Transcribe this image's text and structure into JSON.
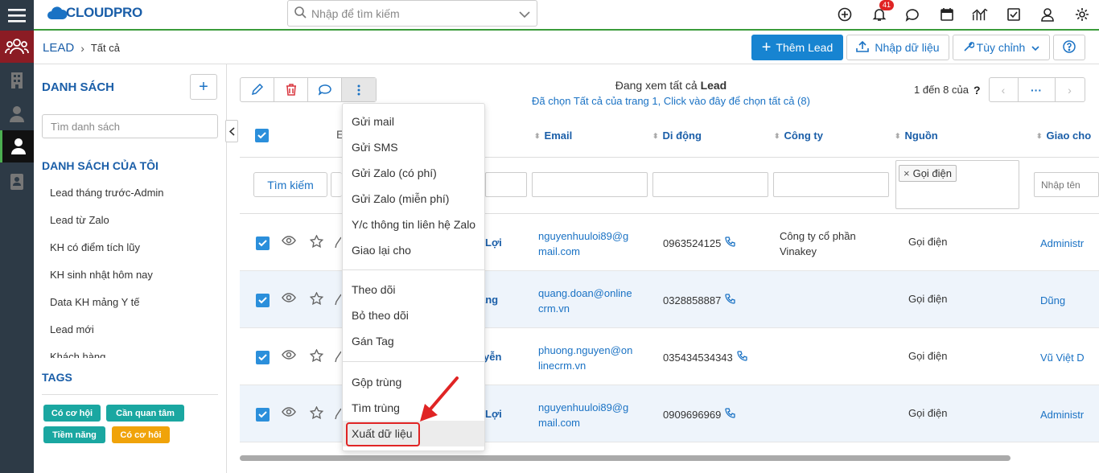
{
  "topbar": {
    "logo_text": "CLOUDPRO",
    "search_placeholder": "Nhập để tìm kiếm",
    "notification_count": "41"
  },
  "breadcrumb": {
    "module": "LEAD",
    "view": "Tất cả"
  },
  "actions": {
    "add": "Thêm Lead",
    "import": "Nhập dữ liệu",
    "customize": "Tùy chỉnh"
  },
  "left": {
    "lists_title": "DANH SÁCH",
    "list_search_placeholder": "Tìm danh sách",
    "my_lists_title": "DANH SÁCH CỦA TÔI",
    "my_lists": [
      "Lead tháng trước-Admin",
      "Lead từ Zalo",
      "KH có điểm tích lũy",
      "KH sinh nhật hôm nay",
      "Data KH mảng Y tế",
      "Lead mới",
      "Khách hàng"
    ],
    "tags_title": "TAGS",
    "tags": [
      {
        "label": "Có cơ hội",
        "color": "#1aa7a1"
      },
      {
        "label": "Cần quan tâm",
        "color": "#1aa7a1"
      },
      {
        "label": "Tiềm năng",
        "color": "#1aa7a1"
      },
      {
        "label": "Có cơ hôi",
        "color": "#f0a30a"
      }
    ]
  },
  "view": {
    "line1_prefix": "Đang xem tất cả",
    "line1_module": "Lead",
    "line2": "Đã chọn Tất cả của trang 1, Click vào đây để chọn tất cả (8)",
    "pager_text": "1 đến 8 của",
    "pager_q": "?"
  },
  "grid": {
    "columns": [
      "Email",
      "Di động",
      "Công ty",
      "Nguồn",
      "Giao cho"
    ],
    "search_button": "Tìm kiếm",
    "source_filter_tag": "Gọi điện",
    "owner_filter_placeholder": "Nhập tên",
    "rows": [
      {
        "name": "Lợi",
        "email1": "nguyenhuuloi89@g",
        "email2": "mail.com",
        "phone": "0963524125",
        "company1": "Công ty cổ phần",
        "company2": "Vinakey",
        "source": "Gọi điện",
        "owner": "Administr"
      },
      {
        "name": "ang",
        "email1": "quang.doan@online",
        "email2": "crm.vn",
        "phone": "0328858887",
        "company1": "",
        "company2": "",
        "source": "Gọi điện",
        "owner": "Dũng"
      },
      {
        "name": "yễn",
        "email1": "phuong.nguyen@on",
        "email2": "linecrm.vn",
        "phone": "035434534343",
        "company1": "",
        "company2": "",
        "source": "Gọi điện",
        "owner": "Vũ Việt D"
      },
      {
        "name": "Lợi",
        "email1": "nguyenhuuloi89@g",
        "email2": "mail.com",
        "phone": "0909696969",
        "company1": "",
        "company2": "",
        "source": "Gọi điện",
        "owner": "Administr"
      }
    ]
  },
  "menu": {
    "items": [
      "Gửi mail",
      "Gửi SMS",
      "Gửi Zalo (có phí)",
      "Gửi Zalo (miễn phí)",
      "Y/c thông tin liên hệ Zalo",
      "Giao lại cho",
      "Theo dõi",
      "Bỏ theo dõi",
      "Gán Tag",
      "Gộp trùng",
      "Tìm trùng",
      "Xuất dữ liệu"
    ],
    "highlighted": "Xuất dữ liệu"
  },
  "annotation": {
    "arrow_color": "#e02424"
  }
}
